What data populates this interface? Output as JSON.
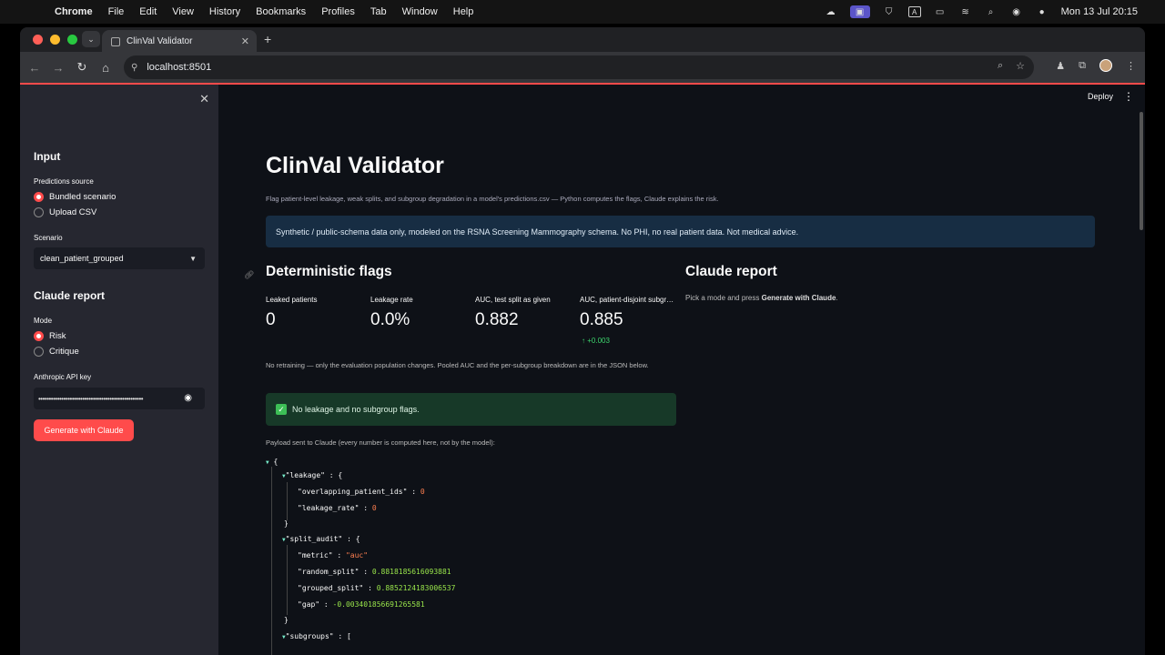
{
  "menubar": {
    "app": "Chrome",
    "items": [
      "File",
      "Edit",
      "View",
      "History",
      "Bookmarks",
      "Profiles",
      "Tab",
      "Window",
      "Help"
    ],
    "clock": "Mon 13 Jul  20:15"
  },
  "browser": {
    "tab_title": "ClinVal Validator",
    "url": "localhost:8501"
  },
  "header": {
    "deploy_label": "Deploy"
  },
  "sidebar": {
    "input_heading": "Input",
    "predictions_source_label": "Predictions source",
    "source_options": [
      "Bundled scenario",
      "Upload CSV"
    ],
    "source_selected": "Bundled scenario",
    "scenario_label": "Scenario",
    "scenario_value": "clean_patient_grouped",
    "claude_heading": "Claude report",
    "mode_label": "Mode",
    "mode_options": [
      "Risk",
      "Critique"
    ],
    "mode_selected": "Risk",
    "api_key_label": "Anthropic API key",
    "api_key_masked": "••••••••••••••••••••••••••••••••••••••••••••••••••",
    "generate_label": "Generate with Claude"
  },
  "main": {
    "title": "ClinVal Validator",
    "caption": "Flag patient-level leakage, weak splits, and subgroup degradation in a model's predictions.csv — Python computes the flags, Claude explains the risk.",
    "info": "Synthetic / public-schema data only, modeled on the RSNA Screening Mammography schema. No PHI, no real patient data. Not medical advice.",
    "flags_heading": "Deterministic flags",
    "metrics": [
      {
        "label": "Leaked patients",
        "value": "0"
      },
      {
        "label": "Leakage rate",
        "value": "0.0%"
      },
      {
        "label": "AUC, test split as given",
        "value": "0.882"
      },
      {
        "label": "AUC, patient-disjoint subgroups",
        "value": "0.885",
        "delta": "+0.003"
      }
    ],
    "note": "No retraining — only the evaluation population changes. Pooled AUC and the per-subgroup breakdown are in the JSON below.",
    "success": "No leakage and no subgroup flags.",
    "payload_label": "Payload sent to Claude (every number is computed here, not by the model):",
    "claude_heading": "Claude report",
    "claude_hint_pre": "Pick a mode and press ",
    "claude_hint_bold": "Generate with Claude",
    "claude_hint_post": "."
  },
  "json_payload": {
    "leakage_key": "\"leakage\"",
    "overlapping_patient_ids": "0",
    "leakage_rate": "0",
    "split_audit_key": "\"split_audit\"",
    "metric": "\"auc\"",
    "random_split": "0.8818185616093881",
    "grouped_split": "0.8852124183006537",
    "gap": "-0.003401856691265581",
    "subgroups_key": "\"subgroups\""
  },
  "colors": {
    "accent": "#ff4b4b",
    "background": "#0e1117",
    "sidebar": "#262730",
    "delta": "#3dd56d"
  }
}
